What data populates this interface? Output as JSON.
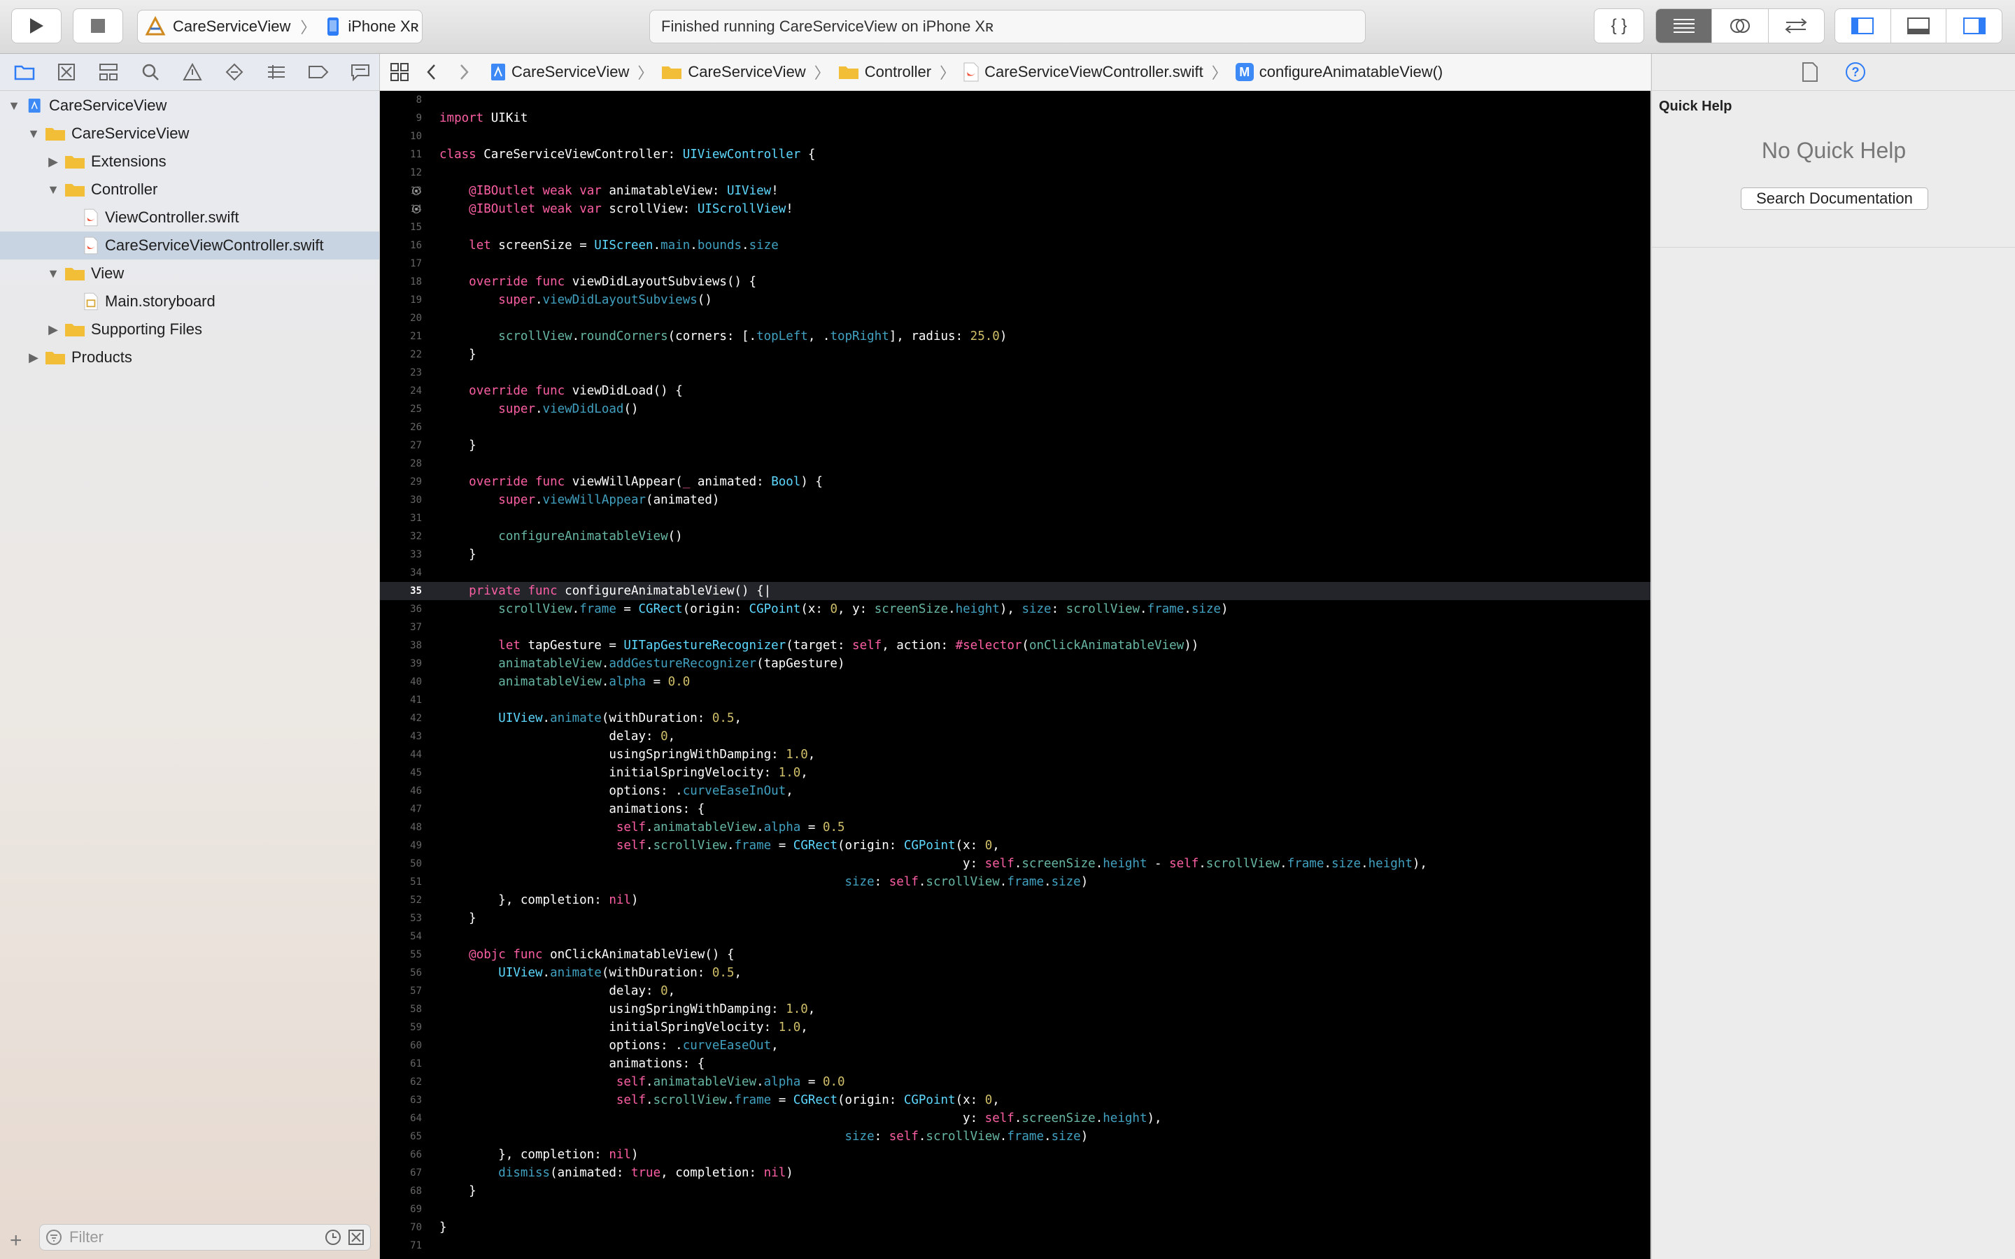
{
  "toolbar": {
    "scheme_name": "CareServiceView",
    "device_name": "iPhone Xʀ",
    "status": "Finished running CareServiceView on iPhone Xʀ",
    "library_label": "{ }"
  },
  "navigator": {
    "tree": [
      {
        "label": "CareServiceView",
        "depth": 0,
        "kind": "project",
        "disclosure": "open"
      },
      {
        "label": "CareServiceView",
        "depth": 1,
        "kind": "folder",
        "disclosure": "open"
      },
      {
        "label": "Extensions",
        "depth": 2,
        "kind": "folder",
        "disclosure": "closed"
      },
      {
        "label": "Controller",
        "depth": 2,
        "kind": "folder",
        "disclosure": "open"
      },
      {
        "label": "ViewController.swift",
        "depth": 3,
        "kind": "swift"
      },
      {
        "label": "CareServiceViewController.swift",
        "depth": 3,
        "kind": "swift",
        "selected": true
      },
      {
        "label": "View",
        "depth": 2,
        "kind": "folder",
        "disclosure": "open"
      },
      {
        "label": "Main.storyboard",
        "depth": 3,
        "kind": "storyboard"
      },
      {
        "label": "Supporting Files",
        "depth": 2,
        "kind": "folder",
        "disclosure": "closed"
      },
      {
        "label": "Products",
        "depth": 1,
        "kind": "folder",
        "disclosure": "closed"
      }
    ],
    "filter_placeholder": "Filter"
  },
  "jumpbar": {
    "crumbs": [
      "CareServiceView",
      "CareServiceView",
      "Controller",
      "CareServiceViewController.swift",
      "configureAnimatableView()"
    ],
    "method_badge": "M"
  },
  "editor": {
    "current_line": 35,
    "lines": [
      {
        "n": "8",
        "code": ""
      },
      {
        "n": "9",
        "code": "import UIKit"
      },
      {
        "n": "10",
        "code": ""
      },
      {
        "n": "11",
        "code": "class CareServiceViewController: UIViewController {"
      },
      {
        "n": "12",
        "code": ""
      },
      {
        "n": "13",
        "code": "    @IBOutlet weak var animatableView: UIView!",
        "bp": true
      },
      {
        "n": "14",
        "code": "    @IBOutlet weak var scrollView: UIScrollView!",
        "bp": true
      },
      {
        "n": "15",
        "code": ""
      },
      {
        "n": "16",
        "code": "    let screenSize = UIScreen.main.bounds.size"
      },
      {
        "n": "17",
        "code": ""
      },
      {
        "n": "18",
        "code": "    override func viewDidLayoutSubviews() {"
      },
      {
        "n": "19",
        "code": "        super.viewDidLayoutSubviews()"
      },
      {
        "n": "20",
        "code": ""
      },
      {
        "n": "21",
        "code": "        scrollView.roundCorners(corners: [.topLeft, .topRight], radius: 25.0)"
      },
      {
        "n": "22",
        "code": "    }"
      },
      {
        "n": "23",
        "code": ""
      },
      {
        "n": "24",
        "code": "    override func viewDidLoad() {"
      },
      {
        "n": "25",
        "code": "        super.viewDidLoad()"
      },
      {
        "n": "26",
        "code": ""
      },
      {
        "n": "27",
        "code": "    }"
      },
      {
        "n": "28",
        "code": ""
      },
      {
        "n": "29",
        "code": "    override func viewWillAppear(_ animated: Bool) {"
      },
      {
        "n": "30",
        "code": "        super.viewWillAppear(animated)"
      },
      {
        "n": "31",
        "code": ""
      },
      {
        "n": "32",
        "code": "        configureAnimatableView()"
      },
      {
        "n": "33",
        "code": "    }"
      },
      {
        "n": "34",
        "code": ""
      },
      {
        "n": "35",
        "code": "    private func configureAnimatableView() {|"
      },
      {
        "n": "36",
        "code": "        scrollView.frame = CGRect(origin: CGPoint(x: 0, y: screenSize.height), size: scrollView.frame.size)"
      },
      {
        "n": "37",
        "code": ""
      },
      {
        "n": "38",
        "code": "        let tapGesture = UITapGestureRecognizer(target: self, action: #selector(onClickAnimatableView))"
      },
      {
        "n": "39",
        "code": "        animatableView.addGestureRecognizer(tapGesture)"
      },
      {
        "n": "40",
        "code": "        animatableView.alpha = 0.0"
      },
      {
        "n": "41",
        "code": ""
      },
      {
        "n": "42",
        "code": "        UIView.animate(withDuration: 0.5,"
      },
      {
        "n": "43",
        "code": "                       delay: 0,"
      },
      {
        "n": "44",
        "code": "                       usingSpringWithDamping: 1.0,"
      },
      {
        "n": "45",
        "code": "                       initialSpringVelocity: 1.0,"
      },
      {
        "n": "46",
        "code": "                       options: .curveEaseInOut,"
      },
      {
        "n": "47",
        "code": "                       animations: {"
      },
      {
        "n": "48",
        "code": "                        self.animatableView.alpha = 0.5"
      },
      {
        "n": "49",
        "code": "                        self.scrollView.frame = CGRect(origin: CGPoint(x: 0,"
      },
      {
        "n": "50",
        "code": "                                                                       y: self.screenSize.height - self.scrollView.frame.size.height),"
      },
      {
        "n": "51",
        "code": "                                                       size: self.scrollView.frame.size)"
      },
      {
        "n": "52",
        "code": "        }, completion: nil)"
      },
      {
        "n": "53",
        "code": "    }"
      },
      {
        "n": "54",
        "code": ""
      },
      {
        "n": "55",
        "code": "    @objc func onClickAnimatableView() {"
      },
      {
        "n": "56",
        "code": "        UIView.animate(withDuration: 0.5,"
      },
      {
        "n": "57",
        "code": "                       delay: 0,"
      },
      {
        "n": "58",
        "code": "                       usingSpringWithDamping: 1.0,"
      },
      {
        "n": "59",
        "code": "                       initialSpringVelocity: 1.0,"
      },
      {
        "n": "60",
        "code": "                       options: .curveEaseOut,"
      },
      {
        "n": "61",
        "code": "                       animations: {"
      },
      {
        "n": "62",
        "code": "                        self.animatableView.alpha = 0.0"
      },
      {
        "n": "63",
        "code": "                        self.scrollView.frame = CGRect(origin: CGPoint(x: 0,"
      },
      {
        "n": "64",
        "code": "                                                                       y: self.screenSize.height),"
      },
      {
        "n": "65",
        "code": "                                                       size: self.scrollView.frame.size)"
      },
      {
        "n": "66",
        "code": "        }, completion: nil)"
      },
      {
        "n": "67",
        "code": "        dismiss(animated: true, completion: nil)"
      },
      {
        "n": "68",
        "code": "    }"
      },
      {
        "n": "69",
        "code": ""
      },
      {
        "n": "70",
        "code": "}"
      },
      {
        "n": "71",
        "code": ""
      }
    ]
  },
  "inspector": {
    "title": "Quick Help",
    "empty_text": "No Quick Help",
    "search_button": "Search Documentation",
    "help_glyph": "?"
  },
  "colors": {
    "keyword": "#fc5fa3",
    "type": "#5dd8ff",
    "project_member": "#67b7a4",
    "function": "#41a1c0",
    "number": "#d0bf69",
    "accent": "#2e7cf6"
  }
}
